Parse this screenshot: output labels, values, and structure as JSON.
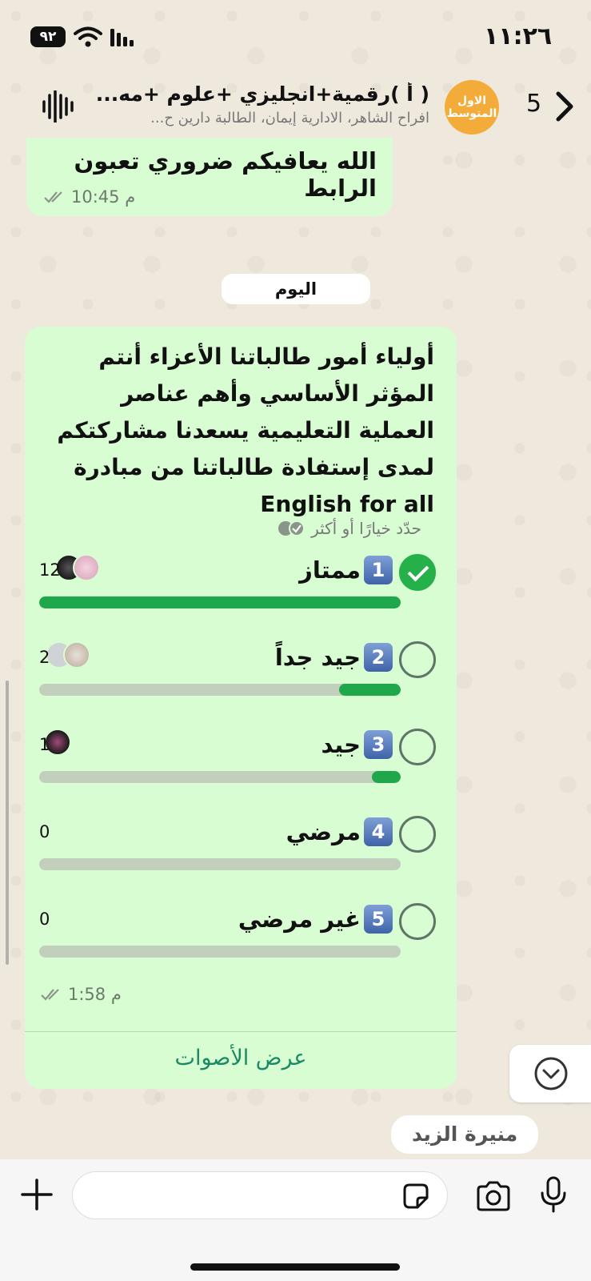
{
  "status_bar": {
    "time": "١١:٢٦",
    "battery": "٩٢"
  },
  "header": {
    "unread_count": "5",
    "avatar_text": "الاول المتوسط",
    "title": "( أ )رقمية+انجليزي +علوم +مه...",
    "subtitle": "افراح الشاهر، الادارية إيمان، الطالبة دارين ح..."
  },
  "previous_message": {
    "text": "الله يعافيكم ضروري تعبون الرابط",
    "time": "10:45 م"
  },
  "date_chip": "اليوم",
  "poll": {
    "question": "أولياء أمور طالباتنا الأعزاء أنتم المؤثر الأساسي وأهم عناصر العملية التعليمية يسعدنا مشاركتكم لمدى إستفادة طالباتنا من مبادرة English for all",
    "hint": "حدّد خيارًا أو أكثر",
    "time": "1:58 م",
    "view_votes_label": "عرض الأصوات",
    "options": [
      {
        "number": "1",
        "label": "ممتاز",
        "votes": "12",
        "fraction": 1.0,
        "selected": true
      },
      {
        "number": "2",
        "label": "جيد جداً",
        "votes": "2",
        "fraction": 0.17,
        "selected": false
      },
      {
        "number": "3",
        "label": "جيد",
        "votes": "1",
        "fraction": 0.08,
        "selected": false
      },
      {
        "number": "4",
        "label": "مرضي",
        "votes": "0",
        "fraction": 0,
        "selected": false
      },
      {
        "number": "5",
        "label": "غير مرضي",
        "votes": "0",
        "fraction": 0,
        "selected": false
      }
    ]
  },
  "typing_chip": "منيرة الزيد",
  "input": {
    "placeholder": ""
  },
  "colors": {
    "bubble": "#d9fdd3",
    "accent": "#1fa84b",
    "avatar": "#f3ac3a"
  }
}
